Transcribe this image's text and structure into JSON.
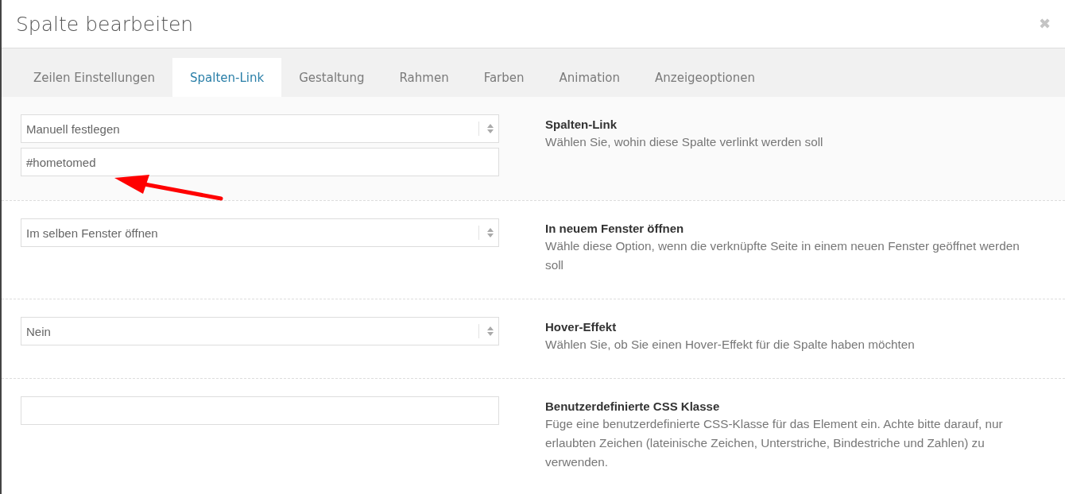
{
  "dialog": {
    "title": "Spalte bearbeiten",
    "close": "✖"
  },
  "tabs": [
    {
      "label": "Zeilen Einstellungen",
      "selected": false
    },
    {
      "label": "Spalten-Link",
      "selected": true
    },
    {
      "label": "Gestaltung",
      "selected": false
    },
    {
      "label": "Rahmen",
      "selected": false
    },
    {
      "label": "Farben",
      "selected": false
    },
    {
      "label": "Animation",
      "selected": false
    },
    {
      "label": "Anzeigeoptionen",
      "selected": false
    }
  ],
  "settings": [
    {
      "title": "Spalten-Link",
      "description": "Wählen Sie, wohin diese Spalte verlinkt werden soll",
      "controls": [
        {
          "kind": "select",
          "value": "Manuell festlegen"
        },
        {
          "kind": "text",
          "value": "#hometomed"
        }
      ]
    },
    {
      "title": "In neuem Fenster öffnen",
      "description": "Wähle diese Option, wenn die verknüpfte Seite in einem neuen Fenster geöffnet werden soll",
      "controls": [
        {
          "kind": "select",
          "value": "Im selben Fenster öffnen"
        }
      ]
    },
    {
      "title": "Hover-Effekt",
      "description": "Wählen Sie, ob Sie einen Hover-Effekt für die Spalte haben möchten",
      "controls": [
        {
          "kind": "select",
          "value": "Nein"
        }
      ]
    },
    {
      "title": "Benutzerdefinierte CSS Klasse",
      "description": "Füge eine benutzerdefinierte CSS-Klasse für das Element ein. Achte bitte darauf, nur erlaubten Zeichen (lateinische Zeichen, Unterstriche, Bindestriche und Zahlen) zu verwenden.",
      "controls": [
        {
          "kind": "text"
        }
      ]
    }
  ]
}
